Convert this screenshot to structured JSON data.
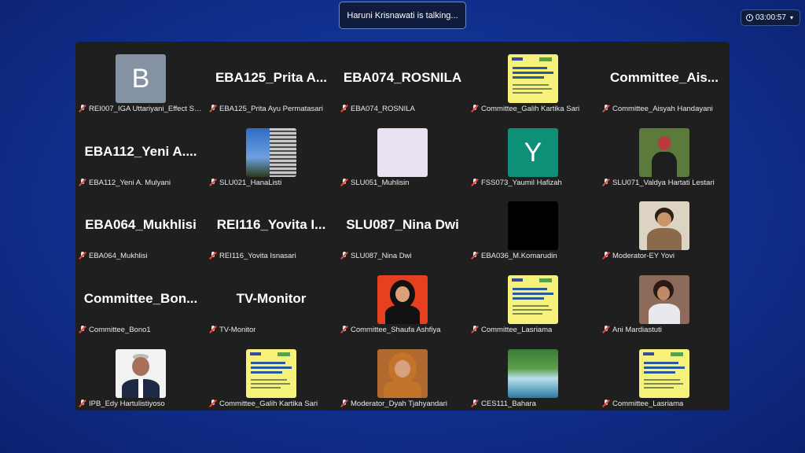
{
  "talking_toast": "Haruni Krisnawati is talking...",
  "timer": {
    "time": "03:00:57"
  },
  "tiles": [
    {
      "big": "",
      "caption": "REI007_IGA Uttariyani_Effect So..."
    },
    {
      "big": "EBA125_Prita  A...",
      "caption": "EBA125_Prita Ayu Permatasari"
    },
    {
      "big": "EBA074_ROSNILA",
      "caption": "EBA074_ROSNILA"
    },
    {
      "big": "",
      "caption": "Committee_Galih Kartika Sari"
    },
    {
      "big": "Committee_Ais...",
      "caption": "Committee_Aisyah Handayani"
    },
    {
      "big": "EBA112_Yeni  A....",
      "caption": "EBA112_Yeni A. Mulyani"
    },
    {
      "big": "",
      "caption": "SLU021_HanaListi"
    },
    {
      "big": "",
      "caption": "SLU051_Muhlisin"
    },
    {
      "big": "",
      "caption": "FSS073_Yaumil Hafizah"
    },
    {
      "big": "",
      "caption": "SLU071_Valdya Hartati Lestari"
    },
    {
      "big": "EBA064_Mukhlisi",
      "caption": "EBA064_Mukhlisi"
    },
    {
      "big": "REI116_Yovita  I...",
      "caption": "REI116_Yovita Isnasari"
    },
    {
      "big": "SLU087_Nina Dwi",
      "caption": "SLU087_Nina Dwi"
    },
    {
      "big": "",
      "caption": "EBA036_M.Komarudin"
    },
    {
      "big": "",
      "caption": "Moderator-EY Yovi"
    },
    {
      "big": "Committee_Bon...",
      "caption": "Committee_Bono1"
    },
    {
      "big": "TV-Monitor",
      "caption": "TV-Monitor"
    },
    {
      "big": "",
      "caption": "Committee_Shaufa Ashfiya"
    },
    {
      "big": "",
      "caption": "Committee_Lasriama"
    },
    {
      "big": "",
      "caption": "Ani Mardiastuti"
    },
    {
      "big": "",
      "caption": "IPB_Edy Hartulistiyoso"
    },
    {
      "big": "",
      "caption": "Committee_Galih Kartika Sari"
    },
    {
      "big": "",
      "caption": "Moderator_Dyah Tjahyandari"
    },
    {
      "big": "",
      "caption": "CES111_Bahara"
    },
    {
      "big": "",
      "caption": "Committee_Lasriama"
    }
  ],
  "avatars": {
    "b": "B",
    "y": "Y"
  },
  "colors": {
    "avatar_b": "#8592a3",
    "avatar_y": "#0e8f78",
    "background": "#123394"
  },
  "icons": [
    "muted-mic-icon",
    "clock-icon",
    "chevron-down-icon"
  ]
}
